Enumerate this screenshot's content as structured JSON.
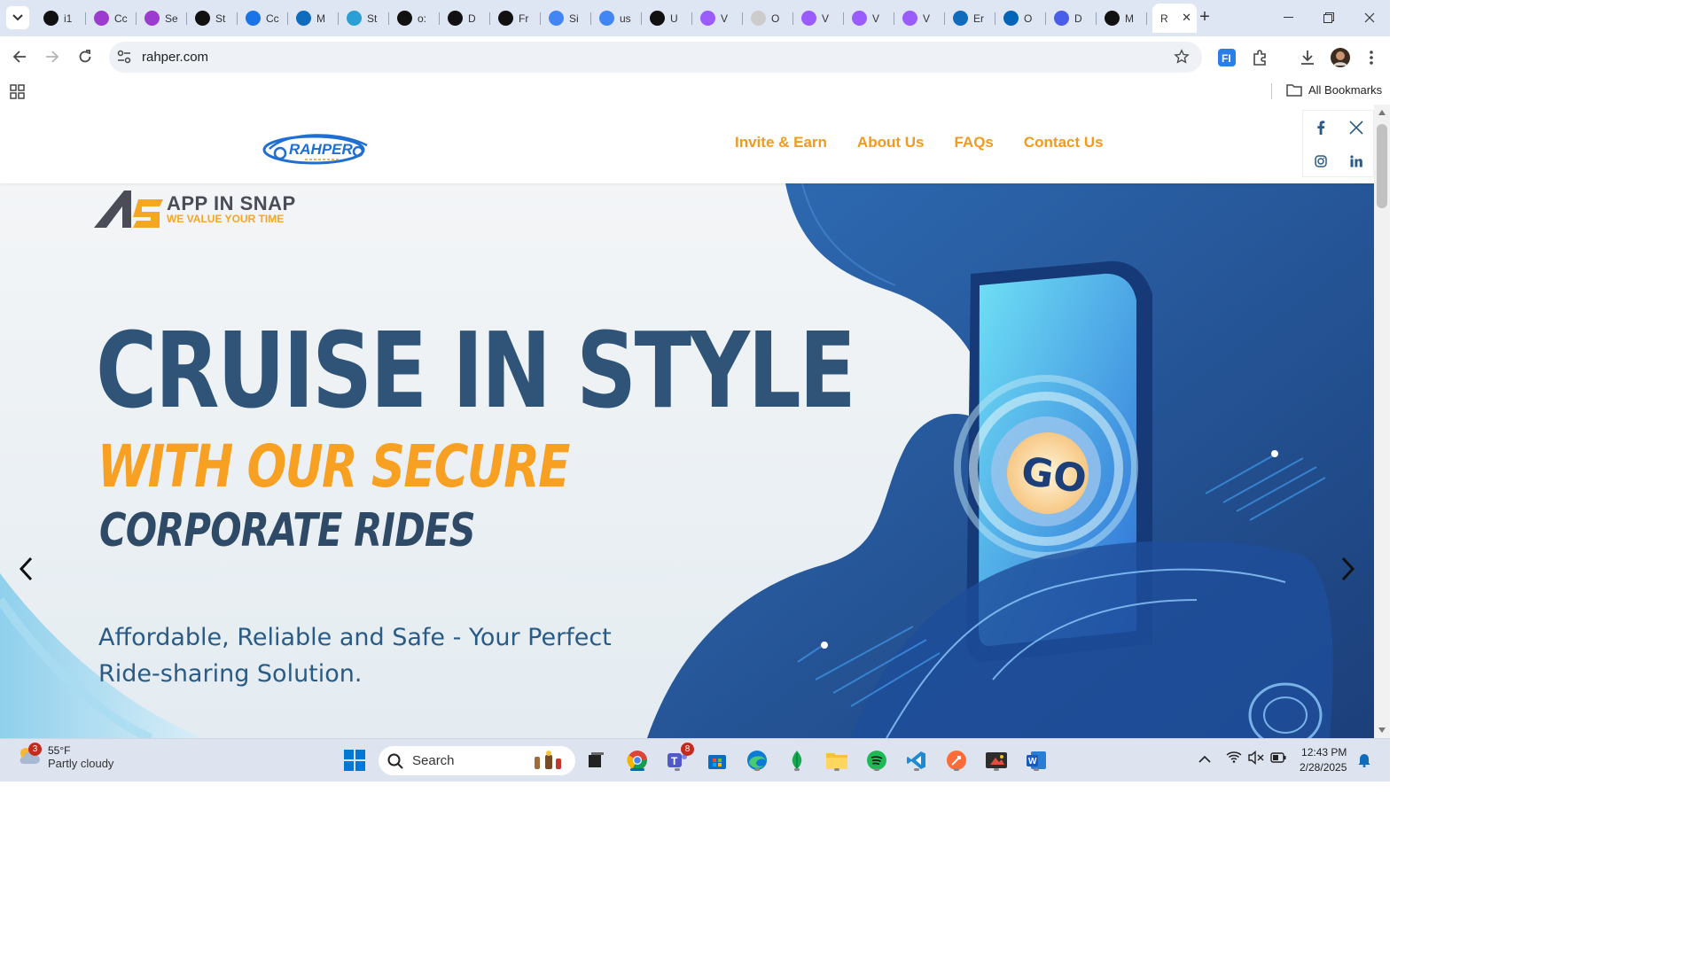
{
  "browser": {
    "tabs": [
      {
        "short": "i1",
        "icon": "threads-icon",
        "color": "#111111"
      },
      {
        "short": "Cc",
        "icon": "ikon-icon",
        "color": "#9b3ccf"
      },
      {
        "short": "Se",
        "icon": "ikon-icon",
        "color": "#9b3ccf"
      },
      {
        "short": "St",
        "icon": "threads-icon",
        "color": "#111111"
      },
      {
        "short": "Cc",
        "icon": "goggles-icon",
        "color": "#1a73e8"
      },
      {
        "short": "M",
        "icon": "outlook-icon",
        "color": "#0f6cbd"
      },
      {
        "short": "St",
        "icon": "wave-icon",
        "color": "#2a9fd6"
      },
      {
        "short": "o:",
        "icon": "github-icon",
        "color": "#111111"
      },
      {
        "short": "D",
        "icon": "threads-icon",
        "color": "#111111"
      },
      {
        "short": "Fr",
        "icon": "svg-icon",
        "color": "#111111"
      },
      {
        "short": "Si",
        "icon": "google-icon",
        "color": "#4285f4"
      },
      {
        "short": "us",
        "icon": "google-icon",
        "color": "#4285f4"
      },
      {
        "short": "U",
        "icon": "threads-icon",
        "color": "#111111"
      },
      {
        "short": "V",
        "icon": "vite-icon",
        "color": "#9b5cff"
      },
      {
        "short": "O",
        "icon": "blank-icon",
        "color": "#cccccc"
      },
      {
        "short": "V",
        "icon": "vite-icon",
        "color": "#9b5cff"
      },
      {
        "short": "V",
        "icon": "vite-icon",
        "color": "#9b5cff"
      },
      {
        "short": "V",
        "icon": "vite-icon",
        "color": "#9b5cff"
      },
      {
        "short": "Er",
        "icon": "outlook-icon",
        "color": "#0f6cbd"
      },
      {
        "short": "O",
        "icon": "onedrive-icon",
        "color": "#0364b8"
      },
      {
        "short": "D",
        "icon": "copilot-icon",
        "color": "#4a5de8"
      },
      {
        "short": "M",
        "icon": "play-icon",
        "color": "#111111"
      }
    ],
    "active_tab": {
      "short": "R",
      "close": "✕"
    },
    "new_tab": "+",
    "url": "rahper.com",
    "bookmarks": {
      "all_label": "All Bookmarks"
    }
  },
  "site": {
    "logo_text": "RAHPER",
    "nav": [
      {
        "label": "Invite & Earn"
      },
      {
        "label": "About Us"
      },
      {
        "label": "FAQs"
      },
      {
        "label": "Contact Us"
      }
    ],
    "hero": {
      "brand_name": "APP IN SNAP",
      "brand_tagline": "WE VALUE YOUR TIME",
      "line1": "CRUISE IN STYLE",
      "line2": "WITH OUR SECURE",
      "line3": "CORPORATE RIDES",
      "subtitle": "Affordable, Reliable and Safe - Your Perfect Ride-sharing Solution.",
      "phone_label": "GO"
    }
  },
  "taskbar": {
    "weather_badge": "3",
    "weather_temp": "55°F",
    "weather_desc": "Partly cloudy",
    "search_placeholder": "Search",
    "teams_badge": "8",
    "time": "12:43 PM",
    "date": "2/28/2025"
  },
  "colors": {
    "accent_orange": "#f09a1e",
    "hero_blue": "#2f5478",
    "tabstrip_bg": "#dfe6f3"
  }
}
